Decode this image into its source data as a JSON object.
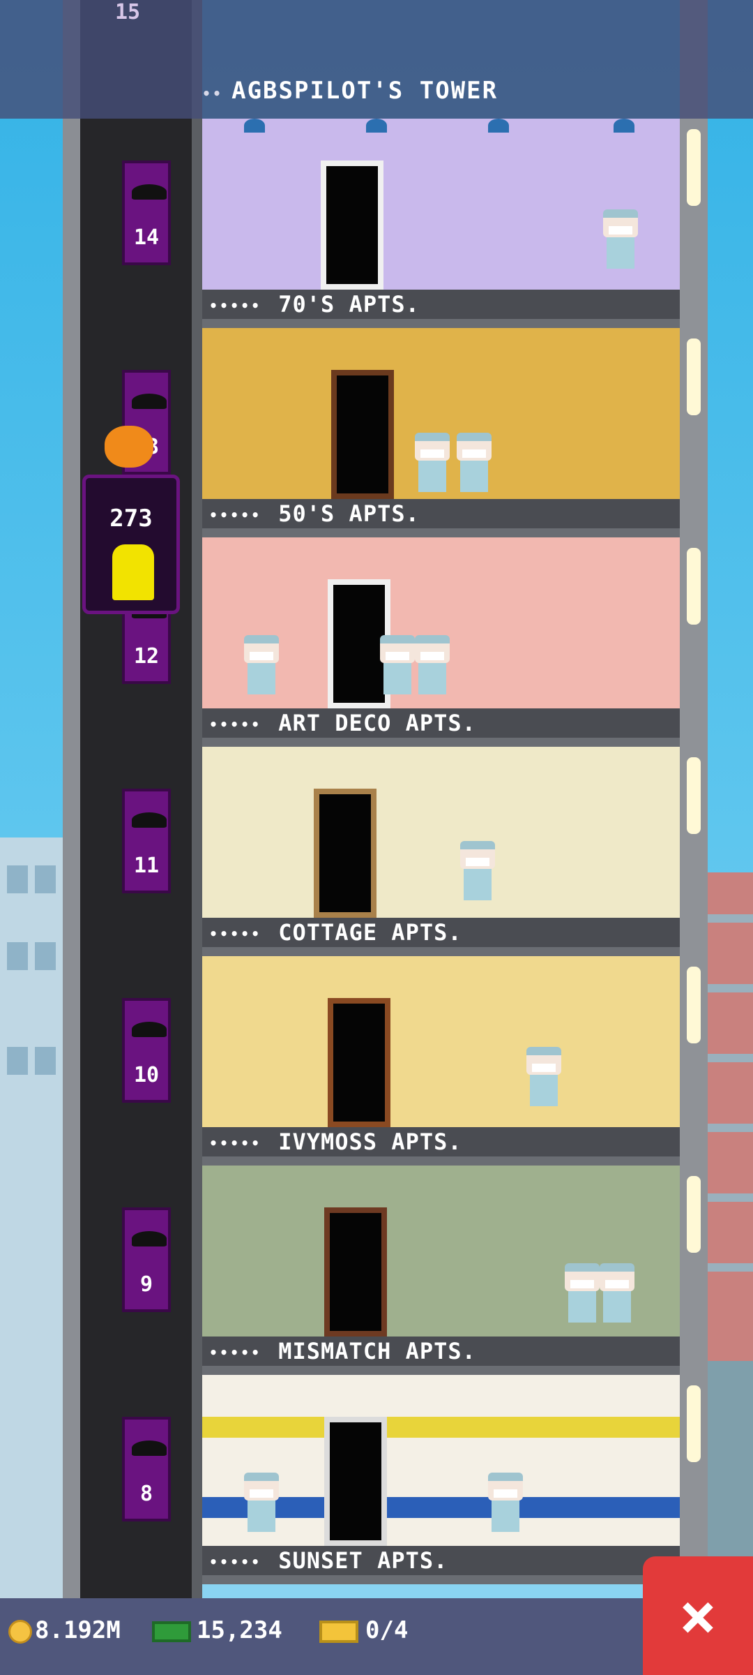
{
  "tower": {
    "title": "AGBSPILOT'S TOWER",
    "top_floor_number": "15"
  },
  "elevator": {
    "passenger_count": "273"
  },
  "floors": [
    {
      "number": "14",
      "name": "70'S APTS.",
      "occupancy": "•••••"
    },
    {
      "number": "13",
      "name": "50'S APTS.",
      "occupancy": "•••••"
    },
    {
      "number": "12",
      "name": "ART DECO APTS.",
      "occupancy": "•••••"
    },
    {
      "number": "11",
      "name": "COTTAGE APTS.",
      "occupancy": "•••••"
    },
    {
      "number": "10",
      "name": "IVYMOSS APTS.",
      "occupancy": "•••••"
    },
    {
      "number": "9",
      "name": "MISMATCH APTS.",
      "occupancy": "•••••"
    },
    {
      "number": "8",
      "name": "SUNSET APTS.",
      "occupancy": "•••••"
    }
  ],
  "status_bar": {
    "coins": "8.192M",
    "bux": "15,234",
    "tickets": "0/4",
    "close_icon": "×"
  },
  "colors": {
    "elevator_purple": "#6a1380",
    "close_red": "#e23a3a",
    "status_bar_bg": "#50577c"
  },
  "icons": [
    "coin-icon",
    "cash-icon",
    "ticket-icon",
    "close-icon",
    "bat-icon",
    "pumpkin-icon"
  ]
}
